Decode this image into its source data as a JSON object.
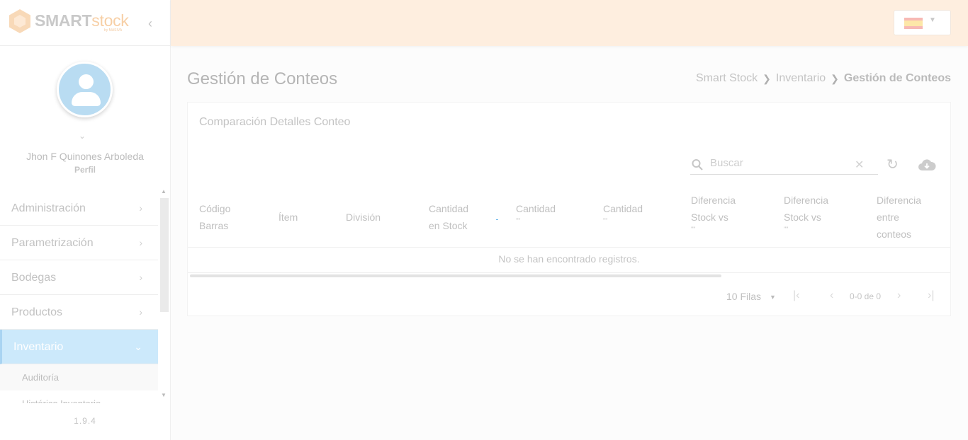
{
  "brand": {
    "name_a": "SMART",
    "name_b": "stock",
    "sub": "by MASIVA"
  },
  "user": {
    "name": "Jhon F Quinones Arboleda",
    "profile_link": "Perfil"
  },
  "menu": {
    "items": [
      {
        "label": "Administración"
      },
      {
        "label": "Parametrización"
      },
      {
        "label": "Bodegas"
      },
      {
        "label": "Productos"
      },
      {
        "label": "Inventario"
      }
    ],
    "sub_items": [
      {
        "label": "Auditoría"
      },
      {
        "label": "Histórico Inventario"
      }
    ]
  },
  "version": "1.9.4",
  "page": {
    "title": "Gestión de Conteos"
  },
  "breadcrumb": [
    "Smart Stock",
    "Inventario",
    "Gestión de Conteos"
  ],
  "card": {
    "title": "Comparación Detalles Conteo"
  },
  "search": {
    "placeholder": "Buscar",
    "value": ""
  },
  "table": {
    "columns": [
      {
        "line1": "Código",
        "line2": "Barras",
        "sub": ""
      },
      {
        "line1": "Ítem",
        "line2": "",
        "sub": ""
      },
      {
        "line1": "División",
        "line2": "",
        "sub": ""
      },
      {
        "line1": "Cantidad",
        "line2": "en Stock",
        "sub": ""
      },
      {
        "line1": "Cantidad",
        "line2": "",
        "sub": "\"\""
      },
      {
        "line1": "Cantidad",
        "line2": "",
        "sub": "\"\""
      },
      {
        "line1": "Diferencia",
        "line2": "Stock vs",
        "sub": "\"\""
      },
      {
        "line1": "Diferencia",
        "line2": "Stock vs",
        "sub": "\"\""
      },
      {
        "line1": "Diferencia",
        "line2": "entre",
        "line3": "conteos",
        "sub": ""
      }
    ],
    "empty_message": "No se han encontrado registros."
  },
  "pagination": {
    "rows_label": "10 Filas",
    "count": "0-0 de 0"
  },
  "colors": {
    "topbar": "#feeedf",
    "active_menu": "#cce9fb",
    "accent": "#f7cfa5"
  }
}
